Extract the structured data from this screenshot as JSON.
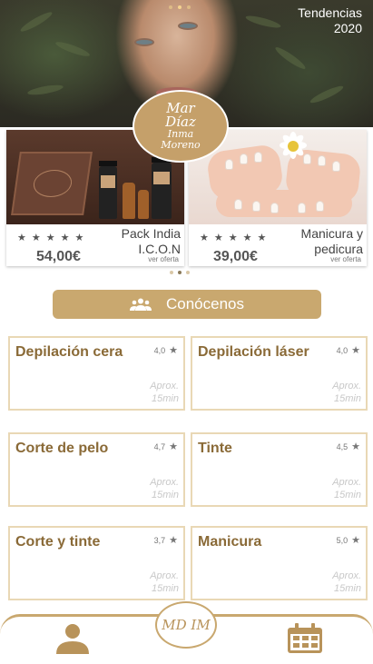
{
  "hero": {
    "title_line1": "Tendencias",
    "title_line2": "2020"
  },
  "logo": {
    "line1": "Mar",
    "line2": "Díaz",
    "line3": "Inma",
    "line4": "Moreno"
  },
  "offers": [
    {
      "name_line1": "Pack India",
      "name_line2": "I.C.O.N",
      "price": "54,00€",
      "rating": 5,
      "link": "ver oferta"
    },
    {
      "name_line1": "Manicura y",
      "name_line2": "pedicura",
      "price": "39,00€",
      "rating": 5,
      "link": "ver oferta"
    }
  ],
  "about_button": {
    "label": "Conócenos",
    "icon": "group-icon"
  },
  "services": [
    {
      "name": "Depilación cera",
      "rating": "4,0",
      "duration_line1": "Aprox.",
      "duration_line2": "15min"
    },
    {
      "name": "Depilación láser",
      "rating": "4,0",
      "duration_line1": "Aprox.",
      "duration_line2": "15min"
    },
    {
      "name": "Corte de pelo",
      "rating": "4,7",
      "duration_line1": "Aprox.",
      "duration_line2": "15min"
    },
    {
      "name": "Tinte",
      "rating": "4,5",
      "duration_line1": "Aprox.",
      "duration_line2": "15min"
    },
    {
      "name": "Corte y tinte",
      "rating": "3,7",
      "duration_line1": "Aprox.",
      "duration_line2": "15min"
    },
    {
      "name": "Manicura",
      "rating": "5,0",
      "duration_line1": "Aprox.",
      "duration_line2": "15min"
    }
  ],
  "bottom_nav": {
    "logo_text": "MD IM",
    "icons": [
      "profile-icon",
      "calendar-icon"
    ]
  },
  "colors": {
    "gold": "#c9a86f",
    "gold_dark": "#8a6a37",
    "border_light": "#e9d8b5"
  }
}
